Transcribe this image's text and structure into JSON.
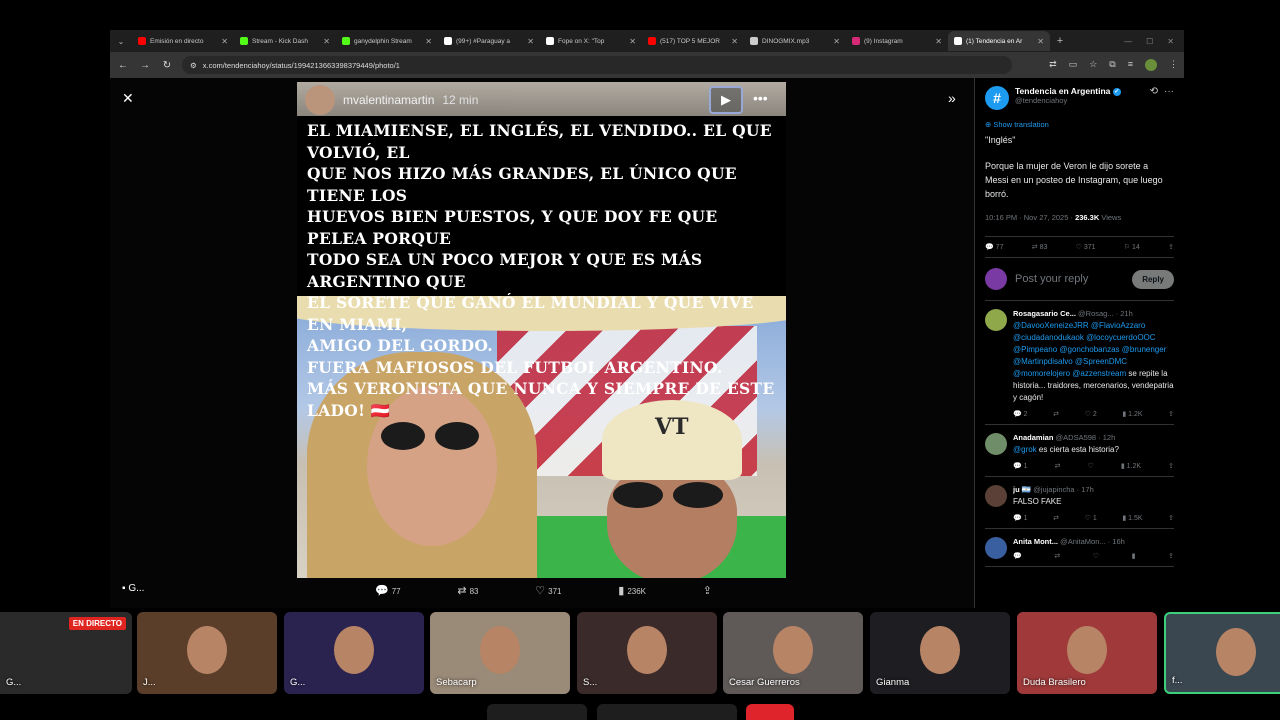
{
  "browser": {
    "tabs": [
      {
        "title": "Emisión en directo",
        "favicon": "youtube-icon",
        "color": "#ff0000"
      },
      {
        "title": "Stream - Kick Dash",
        "favicon": "kick-icon",
        "color": "#53fc18"
      },
      {
        "title": "ganydelphin Stream",
        "favicon": "kick-icon",
        "color": "#53fc18"
      },
      {
        "title": "(99+) #Paraguay a",
        "favicon": "tiktok-icon",
        "color": "#ffffff"
      },
      {
        "title": "Fope on X: \"Top",
        "favicon": "x-icon",
        "color": "#ffffff"
      },
      {
        "title": "(517) TOP 5 MEJOR",
        "favicon": "youtube-icon",
        "color": "#ff0000"
      },
      {
        "title": "DINOGMIX.mp3",
        "favicon": "globe-icon",
        "color": "#cccccc"
      },
      {
        "title": "(9) Instagram",
        "favicon": "instagram-icon",
        "color": "#d62976"
      },
      {
        "title": "(1) Tendencia en Ar",
        "favicon": "x-icon",
        "color": "#ffffff",
        "active": true
      }
    ],
    "url": "x.com/tendenciahoy/status/1994213663398379449/photo/1"
  },
  "post_image": {
    "ig_username": "mvalentinamartin",
    "ig_time": "12 min",
    "caption_lines": [
      "EL MIAMIENSE, EL INGLÉS, EL VENDIDO.. EL QUE VOLVIÓ, EL",
      "QUE NOS HIZO MÁS GRANDES, EL ÚNICO QUE TIENE LOS",
      "HUEVOS BIEN PUESTOS, Y QUE DOY FE QUE PELEA PORQUE",
      "TODO SEA UN POCO MEJOR Y QUE ES MÁS ARGENTINO QUE",
      "EL SORETE QUE GANÓ EL MUNDIAL Y QUE VIVE EN MIAMI,",
      "AMIGO DEL GORDO.",
      "FUERA MAFIOSOS DEL FUTBOL ARGENTINO.",
      "MÁS VERONISTA QUE NUNCA Y SIEMPRE DE ESTE LADO! 🇦🇹"
    ],
    "cap_logo": "VT"
  },
  "photo_actions": {
    "replies": "77",
    "reposts": "83",
    "likes": "371",
    "views": "236K"
  },
  "tweet": {
    "author_name": "Tendencia en Argentina",
    "author_handle": "@tendenciahoy",
    "show_translation": "Show translation",
    "quote": "\"Inglés\"",
    "body": "Porque la mujer de Veron le dijo sorete a Messi en un posteo de Instagram, que luego borró.",
    "time": "10:16 PM · Nov 27, 2025 · ",
    "views": "236.3K",
    "views_label": " Views",
    "stats": {
      "replies": "77",
      "reposts": "83",
      "likes": "371",
      "bookmarks": "14"
    },
    "reply_placeholder": "Post your reply",
    "reply_button": "Reply"
  },
  "replies": [
    {
      "name": "Rosagasario Ce...",
      "handle": "@Rosag... · 21h",
      "mentions": "@DavooXeneizeJRR @FlavioAzzaro @ciudadanodukaok @locoycuerdoOOC @Pimpeano @gonchobanzas @brunenger @Martinpdisalvo @SpreenDMC @momorelojero @azzenstream",
      "text": " se repite la historia... traidores, mercenarios, vendepatria y cagón!",
      "stats": {
        "replies": "2",
        "reposts": "",
        "likes": "2",
        "views": "1.2K"
      },
      "avatar_color": "#8fa84a"
    },
    {
      "name": "Anadamian",
      "handle": "@ADSA598 · 12h",
      "mentions": "@grok",
      "text": " es cierta esta historia?",
      "stats": {
        "replies": "1",
        "reposts": "",
        "likes": "",
        "views": "1.2K"
      },
      "avatar_color": "#6f8d68"
    },
    {
      "name": "ju 🇦🇷",
      "handle": "@jujapincha · 17h",
      "mentions": "",
      "text": "FALSO FAKE",
      "stats": {
        "replies": "1",
        "reposts": "",
        "likes": "1",
        "views": "1.5K"
      },
      "avatar_color": "#5a4036"
    },
    {
      "name": "Anita Mont...",
      "handle": "@AnitaMon... · 16h",
      "mentions": "",
      "text": "",
      "stats": {
        "replies": "",
        "reposts": "",
        "likes": "",
        "views": ""
      },
      "avatar_color": "#3a5fa0"
    }
  ],
  "cam_label": "G...",
  "participants": [
    {
      "name": "G...",
      "live": "EN DIRECTO",
      "bg": "#2a2a2a"
    },
    {
      "name": "J...",
      "bg": "#5a3e2a"
    },
    {
      "name": "G...",
      "bg": "#2a2350"
    },
    {
      "name": "Sebacarp",
      "bg": "#9a8a78"
    },
    {
      "name": "S...",
      "bg": "#3a2a2a"
    },
    {
      "name": "Cesar Guerreros",
      "bg": "#5f5a58"
    },
    {
      "name": "Gianma",
      "bg": "#1e1e22"
    },
    {
      "name": "Duda Brasilero",
      "bg": "#a03a3a"
    },
    {
      "name": "f...",
      "bg": "#3a4650"
    }
  ]
}
